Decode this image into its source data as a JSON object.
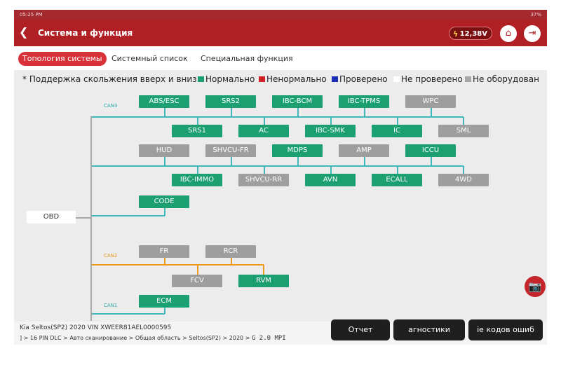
{
  "statusbar": {
    "time": "05:25 PM",
    "battery": "37%"
  },
  "header": {
    "back_glyph": "❮",
    "title": "Система и функция",
    "voltage": "12,38V",
    "home_glyph": "⌂",
    "exit_glyph": "⇥"
  },
  "tabs": [
    "Топология системы",
    "Системный список",
    "Специальная функция"
  ],
  "legend": {
    "note": "* Поддержка скольжения вверх и вниз",
    "items": [
      {
        "label": "Нормально",
        "color": "#1ca071"
      },
      {
        "label": "Ненормально",
        "color": "#d21f26"
      },
      {
        "label": "Проверено",
        "color": "#1a2bb8"
      },
      {
        "label": "Не проверено",
        "color": "#ffffff"
      },
      {
        "label": "Не оборудован",
        "color": "#a6a6a6"
      }
    ]
  },
  "topology": {
    "root": "OBD",
    "buses": [
      "CAN3",
      "CAN2",
      "CAN1"
    ],
    "modules": [
      "ABS/ESC",
      "SRS2",
      "IBC-BCM",
      "IBC-TPMS",
      "WPC",
      "SRS1",
      "AC",
      "IBC-SMK",
      "IC",
      "SML",
      "HUD",
      "SHVCU-FR",
      "MDPS",
      "AMP",
      "ICCU",
      "IBC-IMMO",
      "SHVCU-RR",
      "AVN",
      "ECALL",
      "4WD",
      "CODE",
      "FR",
      "RCR",
      "FCV",
      "RVM",
      "ECM"
    ]
  },
  "vehicle": {
    "line1": "Kia   Seltos(SP2)   2020   VIN   XWEER81AEL0000595",
    "breadcrumb": "] > 16 PIN DLC > Авто сканирование > Общая область > Seltos(SP2) > 2020 > ",
    "engine": "G 2.0 MPI"
  },
  "actions": [
    "Отчет",
    "агностики",
    "іе кодов ошиб"
  ],
  "camera_glyph": "📷"
}
